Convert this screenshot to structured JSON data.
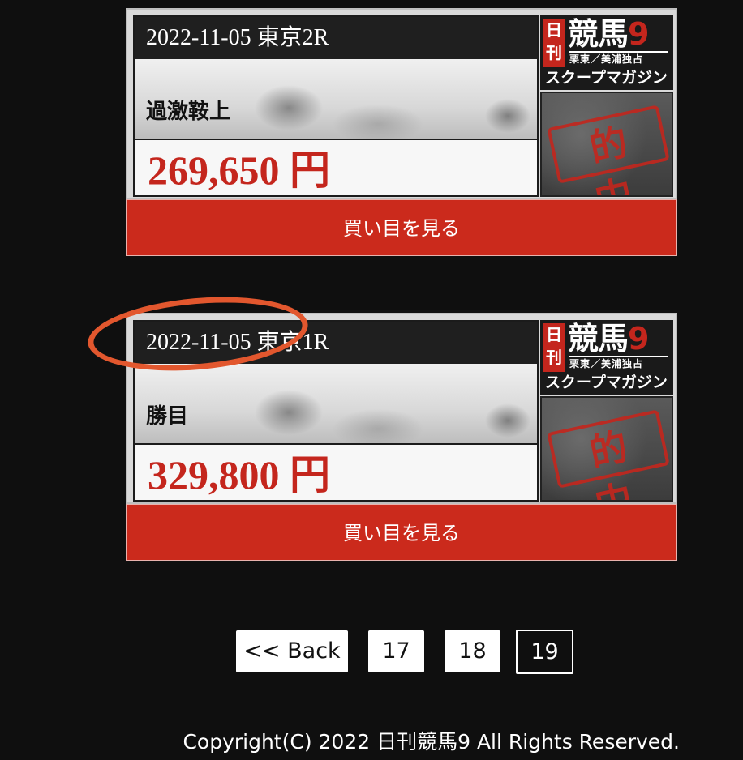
{
  "cards": [
    {
      "date_race": "2022-11-05 東京2R",
      "bet_name": "過激鞍上",
      "payout": "269,650 円",
      "button_label": "買い目を見る"
    },
    {
      "date_race": "2022-11-05 東京1R",
      "bet_name": "勝目",
      "payout": "329,800 円",
      "button_label": "買い目を見る"
    }
  ],
  "logo": {
    "nikkan": "日刊",
    "main": "競馬",
    "nine": "9",
    "sub": "栗東／美浦独占",
    "tagline": "スクープマガジン",
    "stamp": "的中"
  },
  "pagination": {
    "back_label": "<< Back",
    "pages": [
      "17",
      "18",
      "19"
    ],
    "current": "19"
  },
  "footer": {
    "copyright": "Copyright(C) 2022 日刊競馬9 All Rights Reserved."
  },
  "colors": {
    "background": "#0f0f0f",
    "accent_red": "#cb2a1c",
    "payout_red": "#c4261d",
    "annotation_orange": "#e2572e"
  }
}
